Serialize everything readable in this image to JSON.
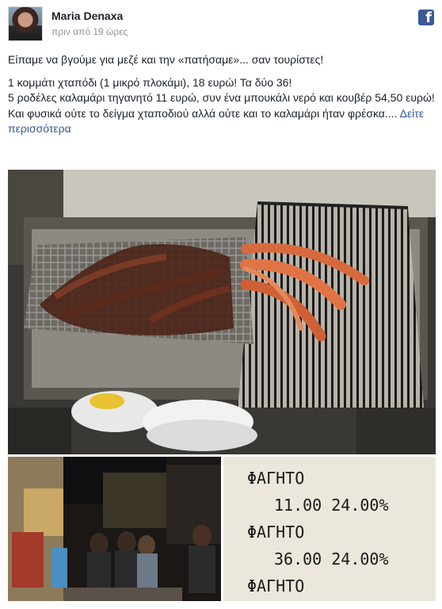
{
  "post": {
    "author": "Maria Denaxa",
    "timestamp": "πριν από 19 ώρες",
    "paragraphs": [
      "Είπαμε να βγούμε για μεζέ και την «πατήσαμε»... σαν τουρίστες!",
      "1 κομμάτι χταπόδι (1 μικρό πλοκάμι), 18 ευρώ! Τα δύο 36!",
      "5 ροδέλες καλαμάρι τηγανητό 11 ευρώ, συν ένα μπουκάλι νερό και κουβέρ 54,50 ευρώ!",
      "Και φυσικά ούτε το δείγμα χταποδιού αλλά ούτε και το καλαμάρι ήταν φρέσκα...."
    ],
    "see_more": "Δείτε περισσότερα"
  },
  "receipt": {
    "lines": [
      "ΦΑΓΗΤΟ",
      "11.00 24.00%",
      "ΦΑΓΗΤΟ",
      "36.00 24.00%",
      "ΦΑΓΗΤΟ"
    ]
  },
  "icons": {
    "facebook": "facebook-logo-icon"
  }
}
